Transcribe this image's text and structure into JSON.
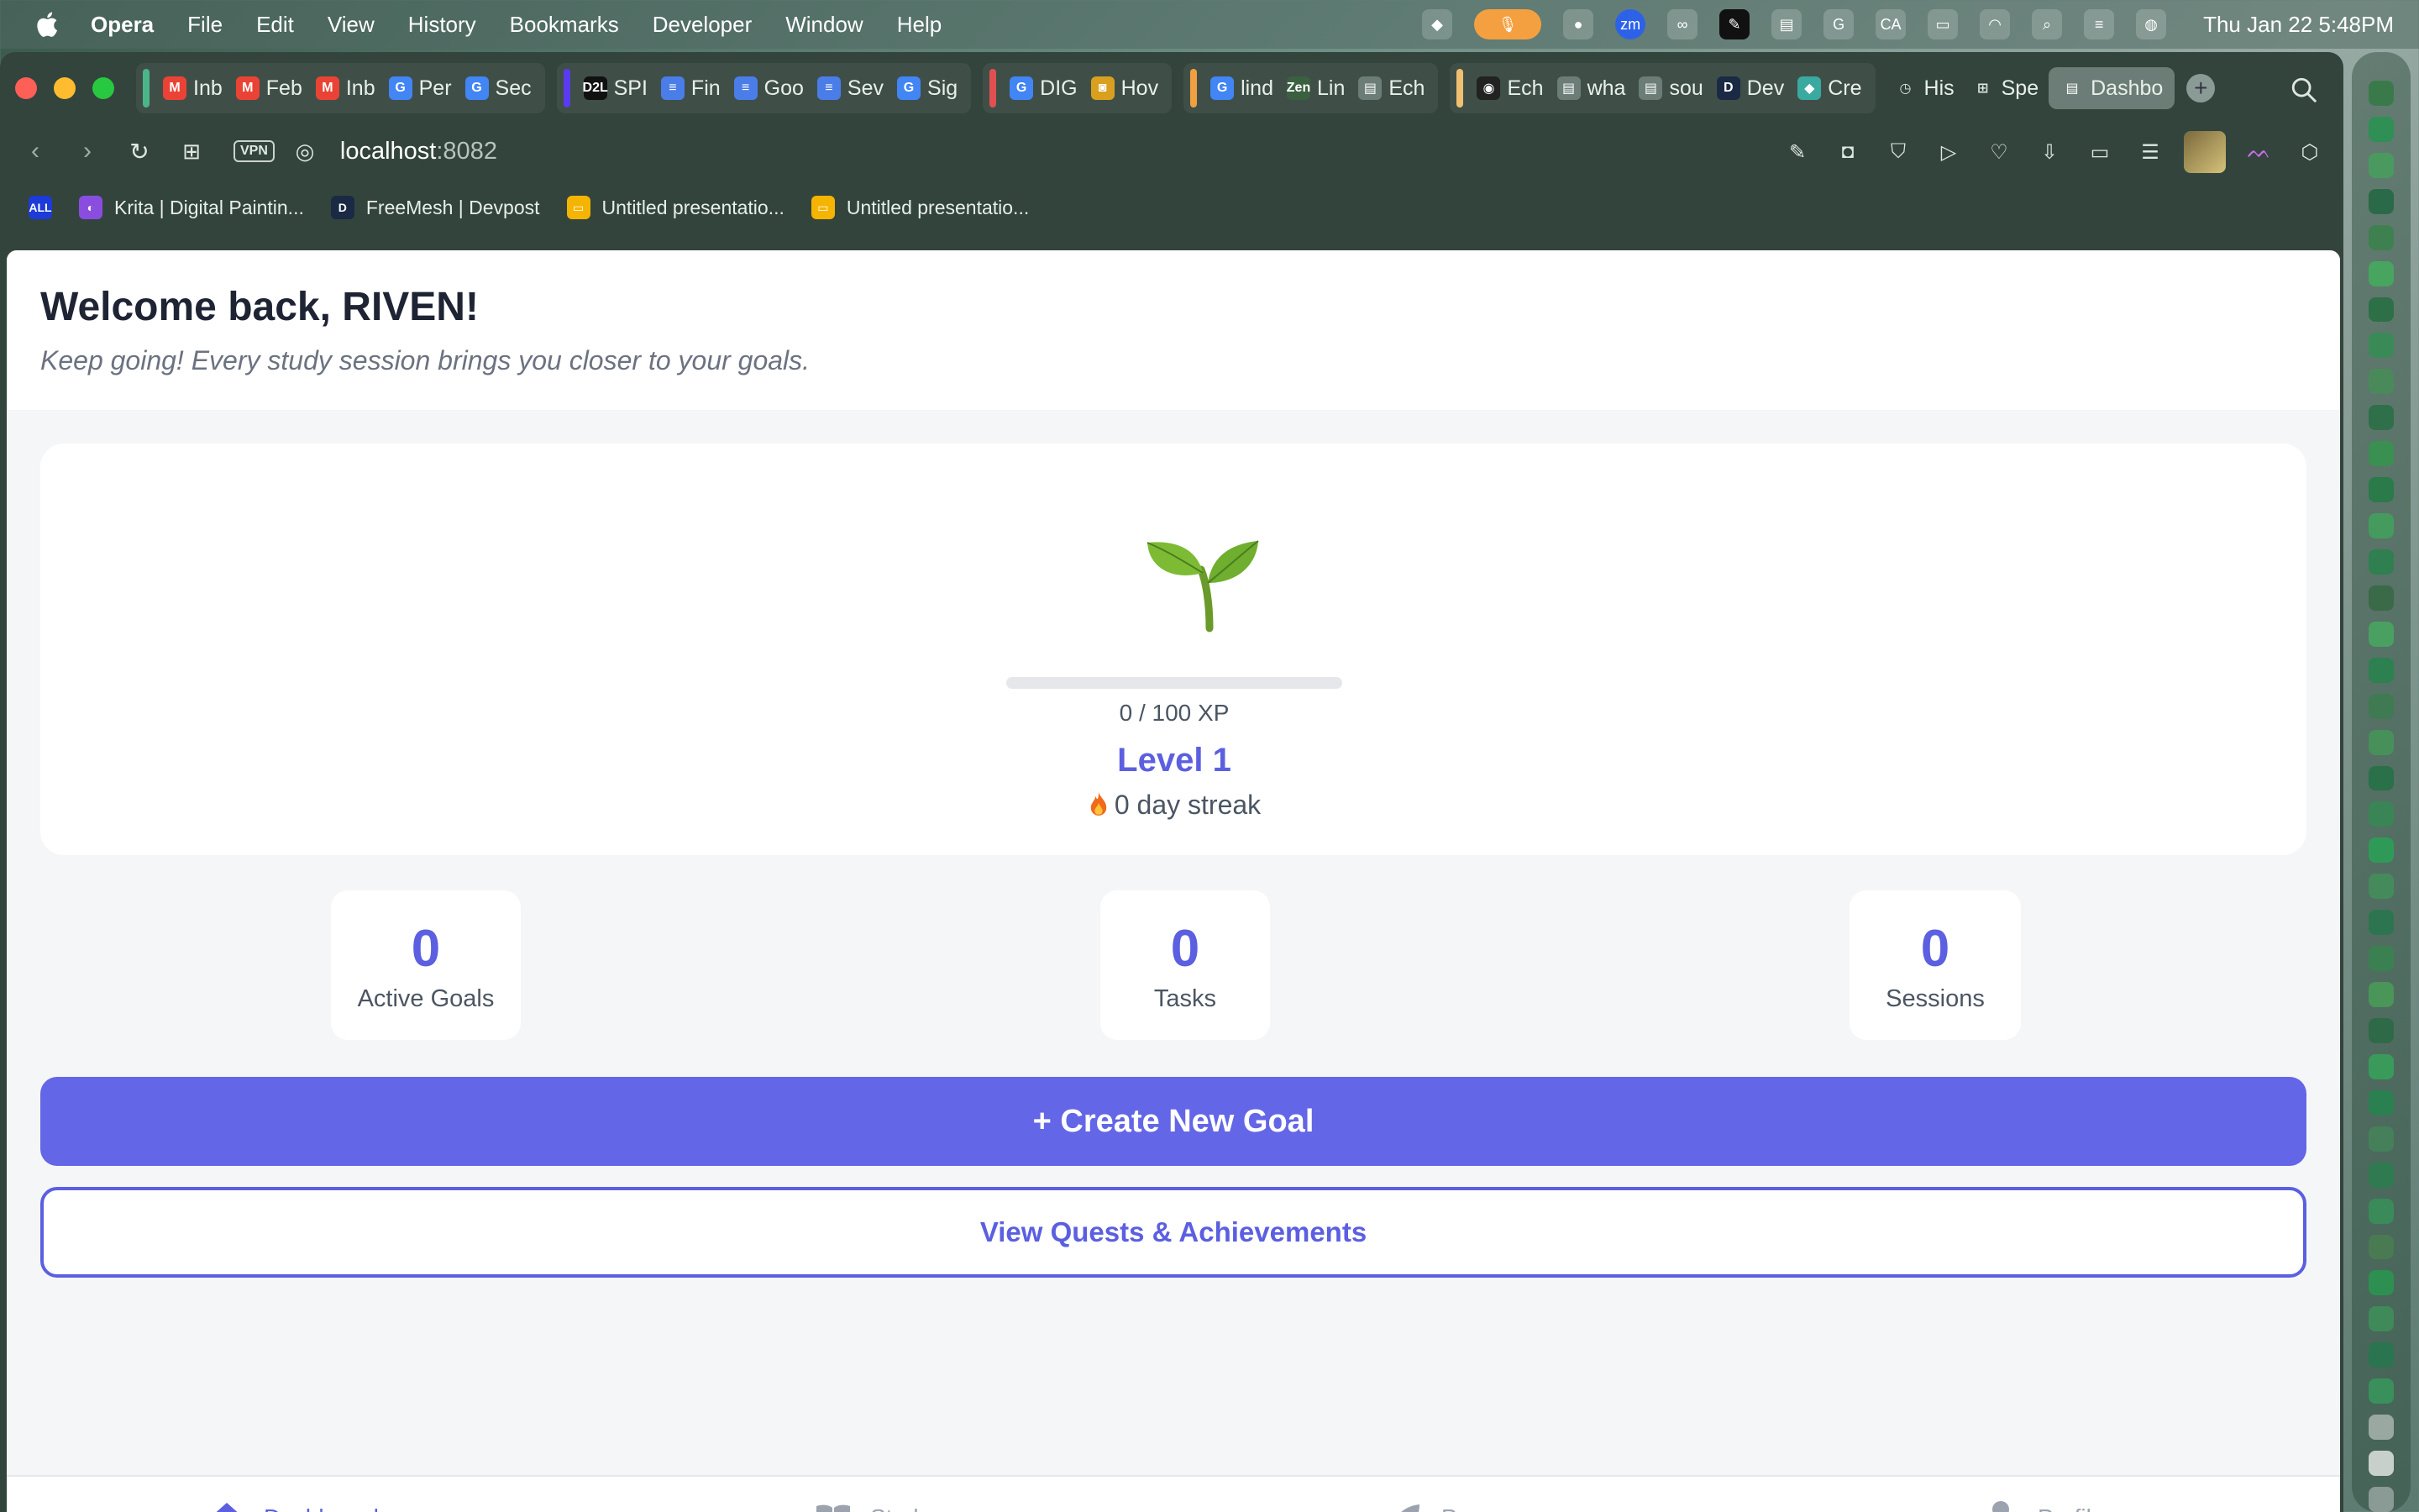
{
  "menubar": {
    "app_name": "Opera",
    "menus": [
      "File",
      "Edit",
      "View",
      "History",
      "Bookmarks",
      "Developer",
      "Window",
      "Help"
    ],
    "status_icons": [
      "package-icon",
      "microphone-icon",
      "grammarly-icon",
      "zoom-icon",
      "creative-cloud-icon",
      "xp-pen-icon",
      "clipboard-icon",
      "grammarly-g-icon",
      "ca-icon",
      "battery-icon",
      "wifi-icon",
      "search-icon",
      "control-center-icon",
      "siri-icon"
    ],
    "zoom_label": "zm",
    "ca_label": "CA",
    "datetime": "Thu Jan 22  5:48PM"
  },
  "tabs": {
    "groups": [
      {
        "color": "#4bb58a",
        "tabs": [
          {
            "label": "Inb",
            "favicon": "gmail-icon",
            "favicon_text": "M",
            "color": "#ea4335"
          },
          {
            "label": "Feb",
            "favicon": "gmail-icon",
            "favicon_text": "M",
            "color": "#ea4335"
          },
          {
            "label": "Inb",
            "favicon": "gmail-icon",
            "favicon_text": "M",
            "color": "#ea4335"
          },
          {
            "label": "Per",
            "favicon": "google-icon",
            "favicon_text": "G",
            "color": "#4285f4"
          },
          {
            "label": "Sec",
            "favicon": "google-icon",
            "favicon_text": "G",
            "color": "#4285f4"
          }
        ]
      },
      {
        "color": "#5b3bf0",
        "tabs": [
          {
            "label": "SPI",
            "favicon": "d2l-icon",
            "favicon_text": "D2L",
            "color": "#111111"
          },
          {
            "label": "Fin",
            "favicon": "google-docs-icon",
            "favicon_text": "≡",
            "color": "#4a7de8"
          },
          {
            "label": "Goo",
            "favicon": "google-docs-icon",
            "favicon_text": "≡",
            "color": "#4a7de8"
          },
          {
            "label": "Sev",
            "favicon": "google-docs-icon",
            "favicon_text": "≡",
            "color": "#4a7de8"
          },
          {
            "label": "Sig",
            "favicon": "google-icon",
            "favicon_text": "G",
            "color": "#4285f4"
          }
        ]
      },
      {
        "color": "#e05050",
        "tabs": [
          {
            "label": "DIG",
            "favicon": "google-icon",
            "favicon_text": "G",
            "color": "#4285f4"
          },
          {
            "label": "Hov",
            "favicon": "chip-icon",
            "favicon_text": "◙",
            "color": "#d9a020"
          }
        ]
      },
      {
        "color": "#f0a040",
        "tabs": [
          {
            "label": "lind",
            "favicon": "google-icon",
            "favicon_text": "G",
            "color": "#4285f4"
          },
          {
            "label": "Lin",
            "favicon": "zen-icon",
            "favicon_text": "Zen",
            "color": "#3a6040"
          },
          {
            "label": "Ech",
            "favicon": "document-icon",
            "favicon_text": "▤",
            "color": "#6b7d76"
          }
        ]
      },
      {
        "color": "#f0c070",
        "tabs": [
          {
            "label": "Ech",
            "favicon": "github-icon",
            "favicon_text": "◉",
            "color": "#222222"
          },
          {
            "label": "wha",
            "favicon": "document-icon",
            "favicon_text": "▤",
            "color": "#6b7d76"
          },
          {
            "label": "sou",
            "favicon": "document-icon",
            "favicon_text": "▤",
            "color": "#6b7d76"
          },
          {
            "label": "Dev",
            "favicon": "devpost-icon",
            "favicon_text": "D",
            "color": "#1a2a44"
          },
          {
            "label": "Cre",
            "favicon": "diamond-icon",
            "favicon_text": "◆",
            "color": "#3aa9a0"
          }
        ]
      }
    ],
    "loose": [
      {
        "label": "His",
        "favicon": "history-icon",
        "favicon_text": "◷"
      },
      {
        "label": "Spe",
        "favicon": "speed-dial-icon",
        "favicon_text": "⊞"
      }
    ],
    "active": {
      "label": "Dashbo",
      "favicon": "document-icon",
      "favicon_text": "▤"
    },
    "new_tab": "+"
  },
  "address_bar": {
    "vpn_label": "VPN",
    "host": "localhost",
    "port": ":8082"
  },
  "bookmarks": [
    {
      "label": "",
      "icon": "all-icon",
      "icon_text": "ALL",
      "color": "#1c3bd8"
    },
    {
      "label": "Krita | Digital Paintin...",
      "icon": "krita-icon",
      "icon_text": "◐",
      "color": "#8a4de0"
    },
    {
      "label": "FreeMesh | Devpost",
      "icon": "devpost-icon",
      "icon_text": "D",
      "color": "#1a2a44"
    },
    {
      "label": "Untitled presentatio...",
      "icon": "slides-icon",
      "icon_text": "▭",
      "color": "#f4b400"
    },
    {
      "label": "Untitled presentatio...",
      "icon": "slides-icon",
      "icon_text": "▭",
      "color": "#f4b400"
    }
  ],
  "page": {
    "welcome_title": "Welcome back, RIVEN!",
    "welcome_subtitle": "Keep going! Every study session brings you closer to your goals.",
    "level_card": {
      "xp_current": 0,
      "xp_max": 100,
      "xp_text": "0 / 100 XP",
      "level_text": "Level 1",
      "streak_text": "0 day streak"
    },
    "stats": [
      {
        "value": "0",
        "label": "Active Goals"
      },
      {
        "value": "0",
        "label": "Tasks"
      },
      {
        "value": "0",
        "label": "Sessions"
      }
    ],
    "create_goal_label": "+ Create New Goal",
    "quests_label": "View Quests & Achievements"
  },
  "bottom_nav": [
    {
      "label": "Dashboard",
      "icon": "home-icon",
      "active": true
    },
    {
      "label": "Study",
      "icon": "book-icon",
      "active": false
    },
    {
      "label": "Progress",
      "icon": "leaf-icon",
      "active": false
    },
    {
      "label": "Profile",
      "icon": "person-icon",
      "active": false
    }
  ],
  "colors": {
    "accent": "#5b5fe0",
    "primary_button": "#6366e6",
    "page_background": "#f5f6f8"
  }
}
